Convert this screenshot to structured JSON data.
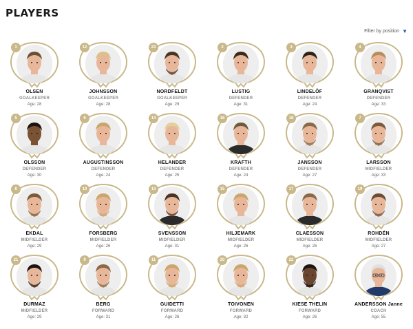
{
  "header": {
    "title": "PLAYERS",
    "filter_label": "Filter by position"
  },
  "colors": {
    "gold": "#c9b88a",
    "filter_caret": "#2a5aa6"
  },
  "players": [
    {
      "number": "1",
      "name": "OLSEN",
      "position": "GOALKEEPER",
      "age": "Age: 28",
      "hair": "#6b4f34",
      "beard": false,
      "shirt": "#e6e6e6"
    },
    {
      "number": "12",
      "name": "JOHNSSON",
      "position": "GOALKEEPER",
      "age": "Age: 28",
      "hair": "#d9c28a",
      "beard": false,
      "shirt": "#e6e6e6"
    },
    {
      "number": "23",
      "name": "NORDFELDT",
      "position": "GOALKEEPER",
      "age": "Age: 29",
      "hair": "#4a3424",
      "beard": true,
      "shirt": "#e6e6e6"
    },
    {
      "number": "2",
      "name": "LUSTIG",
      "position": "DEFENDER",
      "age": "Age: 31",
      "hair": "#3a2a1c",
      "beard": false,
      "shirt": "#e6e6e6"
    },
    {
      "number": "3",
      "name": "LINDELÖF",
      "position": "DEFENDER",
      "age": "Age: 24",
      "hair": "#2e2218",
      "beard": false,
      "shirt": "#e6e6e6"
    },
    {
      "number": "4",
      "name": "GRANQVIST",
      "position": "DEFENDER",
      "age": "Age: 33",
      "hair": "#b88d5e",
      "beard": false,
      "shirt": "#e6e6e6"
    },
    {
      "number": "5",
      "name": "OLSSON",
      "position": "DEFENDER",
      "age": "Age: 30",
      "hair": "#1c1410",
      "beard": false,
      "shirt": "#e6e6e6",
      "skin": "#7a5234"
    },
    {
      "number": "6",
      "name": "AUGUSTINSSON",
      "position": "DEFENDER",
      "age": "Age: 24",
      "hair": "#c9a66b",
      "beard": false,
      "shirt": "#e6e6e6"
    },
    {
      "number": "14",
      "name": "HELANDER",
      "position": "DEFENDER",
      "age": "Age: 25",
      "hair": "#e2cf9a",
      "beard": false,
      "shirt": "#e6e6e6"
    },
    {
      "number": "16",
      "name": "KRAFTH",
      "position": "DEFENDER",
      "age": "Age: 24",
      "hair": "#6e5a3e",
      "beard": false,
      "shirt": "#2b2b2b"
    },
    {
      "number": "18",
      "name": "JANSSON",
      "position": "DEFENDER",
      "age": "Age: 27",
      "hair": "#8a6a46",
      "beard": true,
      "shirt": "#e6e6e6"
    },
    {
      "number": "7",
      "name": "LARSSON",
      "position": "MIDFIELDER",
      "age": "Age: 33",
      "hair": "#7b5a3a",
      "beard": true,
      "shirt": "#e6e6e6"
    },
    {
      "number": "8",
      "name": "EKDAL",
      "position": "MIDFIELDER",
      "age": "Age: 29",
      "hair": "#7b5a3a",
      "beard": true,
      "shirt": "#e6e6e6"
    },
    {
      "number": "10",
      "name": "FORSBERG",
      "position": "MIDFIELDER",
      "age": "Age: 26",
      "hair": "#c9a66b",
      "beard": true,
      "shirt": "#e6e6e6"
    },
    {
      "number": "13",
      "name": "SVENSSON",
      "position": "MIDFIELDER",
      "age": "Age: 31",
      "hair": "#4a3424",
      "beard": true,
      "shirt": "#2b2b2b"
    },
    {
      "number": "15",
      "name": "HILJEMARK",
      "position": "MIDFIELDER",
      "age": "Age: 26",
      "hair": "#c9a66b",
      "beard": false,
      "shirt": "#e6e6e6"
    },
    {
      "number": "17",
      "name": "CLAESSON",
      "position": "MIDFIELDER",
      "age": "Age: 26",
      "hair": "#8a6a46",
      "beard": false,
      "shirt": "#2b2b2b"
    },
    {
      "number": "19",
      "name": "ROHDÉN",
      "position": "MIDFIELDER",
      "age": "Age: 27",
      "hair": "#6b4f34",
      "beard": true,
      "shirt": "#e6e6e6"
    },
    {
      "number": "21",
      "name": "DURMAZ",
      "position": "MIDFIELDER",
      "age": "Age: 29",
      "hair": "#1c1410",
      "beard": true,
      "shirt": "#e6e6e6"
    },
    {
      "number": "9",
      "name": "BERG",
      "position": "FORWARD",
      "age": "Age: 31",
      "hair": "#8a6a46",
      "beard": true,
      "shirt": "#e6e6e6"
    },
    {
      "number": "11",
      "name": "GUIDETTI",
      "position": "FORWARD",
      "age": "Age: 26",
      "hair": "#c9a66b",
      "beard": true,
      "shirt": "#e6e6e6"
    },
    {
      "number": "20",
      "name": "TOIVONEN",
      "position": "FORWARD",
      "age": "Age: 32",
      "hair": "#c9a66b",
      "beard": true,
      "shirt": "#e6e6e6"
    },
    {
      "number": "22",
      "name": "KIESE THELIN",
      "position": "FORWARD",
      "age": "Age: 26",
      "hair": "#1c1410",
      "beard": true,
      "shirt": "#e6e6e6",
      "skin": "#6a4630"
    },
    {
      "number": "",
      "name": "ANDERSSON Janne",
      "position": "COACH",
      "age": "Age: 55",
      "hair": "#e0e0e0",
      "beard": false,
      "shirt": "#223a6a",
      "glasses": true
    }
  ]
}
